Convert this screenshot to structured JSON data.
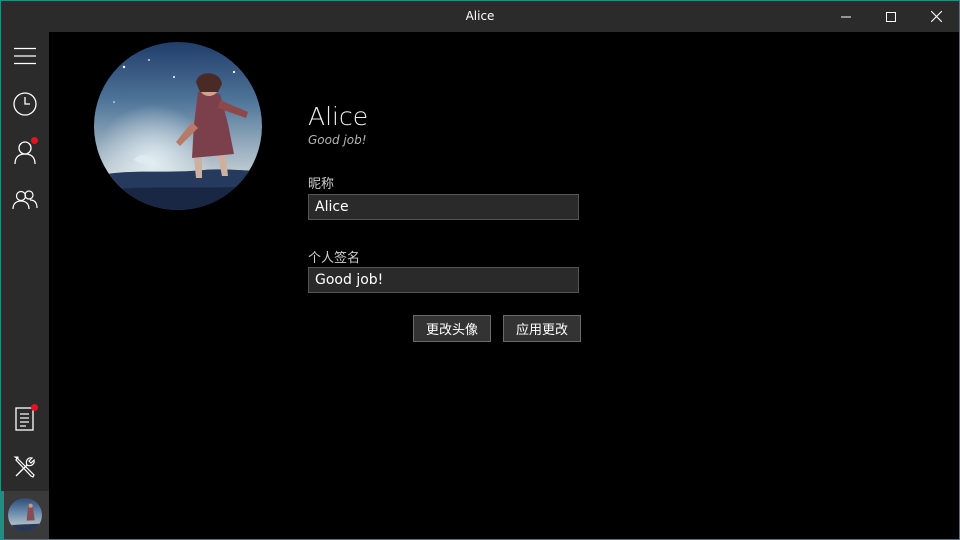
{
  "window": {
    "title": "Alice",
    "border_color": "#1f8f86",
    "controls": [
      "minimize-icon",
      "maximize-icon",
      "close-icon"
    ]
  },
  "sidebar": {
    "items": [
      {
        "name": "menu",
        "icon": "hamburger-icon"
      },
      {
        "name": "history",
        "icon": "clock-icon"
      },
      {
        "name": "contact",
        "icon": "person-icon",
        "badge": true
      },
      {
        "name": "group",
        "icon": "people-icon"
      },
      {
        "name": "notes",
        "icon": "document-icon",
        "badge": true
      },
      {
        "name": "tools",
        "icon": "tools-icon"
      },
      {
        "name": "profile",
        "icon": "avatar",
        "selected": true
      }
    ],
    "badge_color": "#e81123"
  },
  "profile": {
    "name": "Alice",
    "signature": "Good job!"
  },
  "form": {
    "nickname_label": "昵称",
    "nickname_value": "Alice",
    "signature_label": "个人签名",
    "signature_value": "Good job!",
    "change_avatar_label": "更改头像",
    "apply_label": "应用更改"
  }
}
